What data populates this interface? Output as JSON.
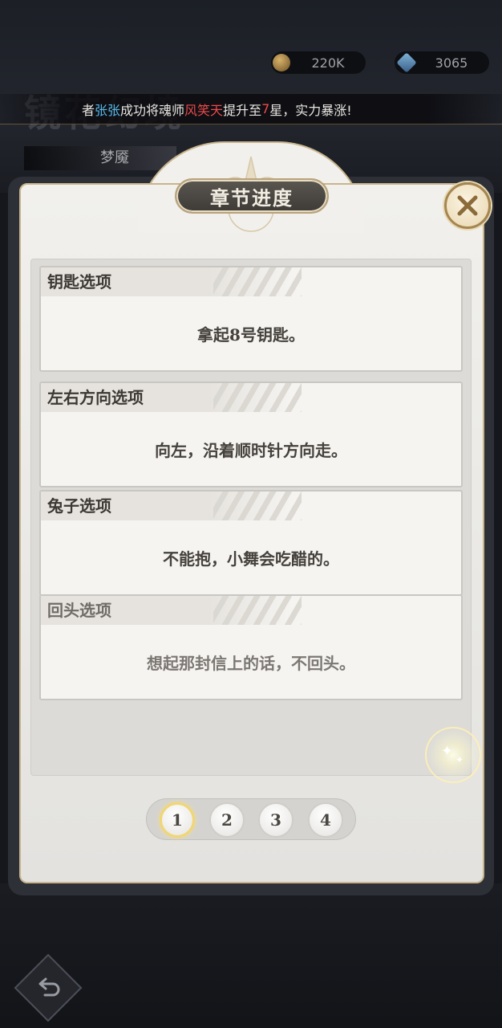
{
  "background": {
    "title": "镜花幻境",
    "subtitle": "梦魇"
  },
  "currency": {
    "gold": "220K",
    "gems": "3065"
  },
  "broadcast": {
    "prefix": "者",
    "name1": "张张",
    "mid": "成功将魂师",
    "name2": "风笑天",
    "mid2": "提升至",
    "star": "7",
    "suffix": "星，实力暴涨!"
  },
  "panel": {
    "title": "章节进度"
  },
  "cards": [
    {
      "title": "钥匙选项",
      "text": "拿起8号钥匙。"
    },
    {
      "title": "左右方向选项",
      "text": "向左，沿着顺时针方向走。"
    },
    {
      "title": "兔子选项",
      "text": "不能抱，小舞会吃醋的。"
    },
    {
      "title": "回头选项",
      "text": "想起那封信上的话，不回头。"
    }
  ],
  "pager": {
    "pages": [
      "1",
      "2",
      "3",
      "4"
    ],
    "active": 1
  },
  "colors": {
    "name_blue": "#56b9ea",
    "name_red": "#ec4b4b",
    "gold_border": "#c9b58e"
  },
  "icons": {
    "close": "close-icon",
    "back": "back-arrow-icon",
    "gold": "gold-coin-icon",
    "gem": "diamond-icon"
  }
}
